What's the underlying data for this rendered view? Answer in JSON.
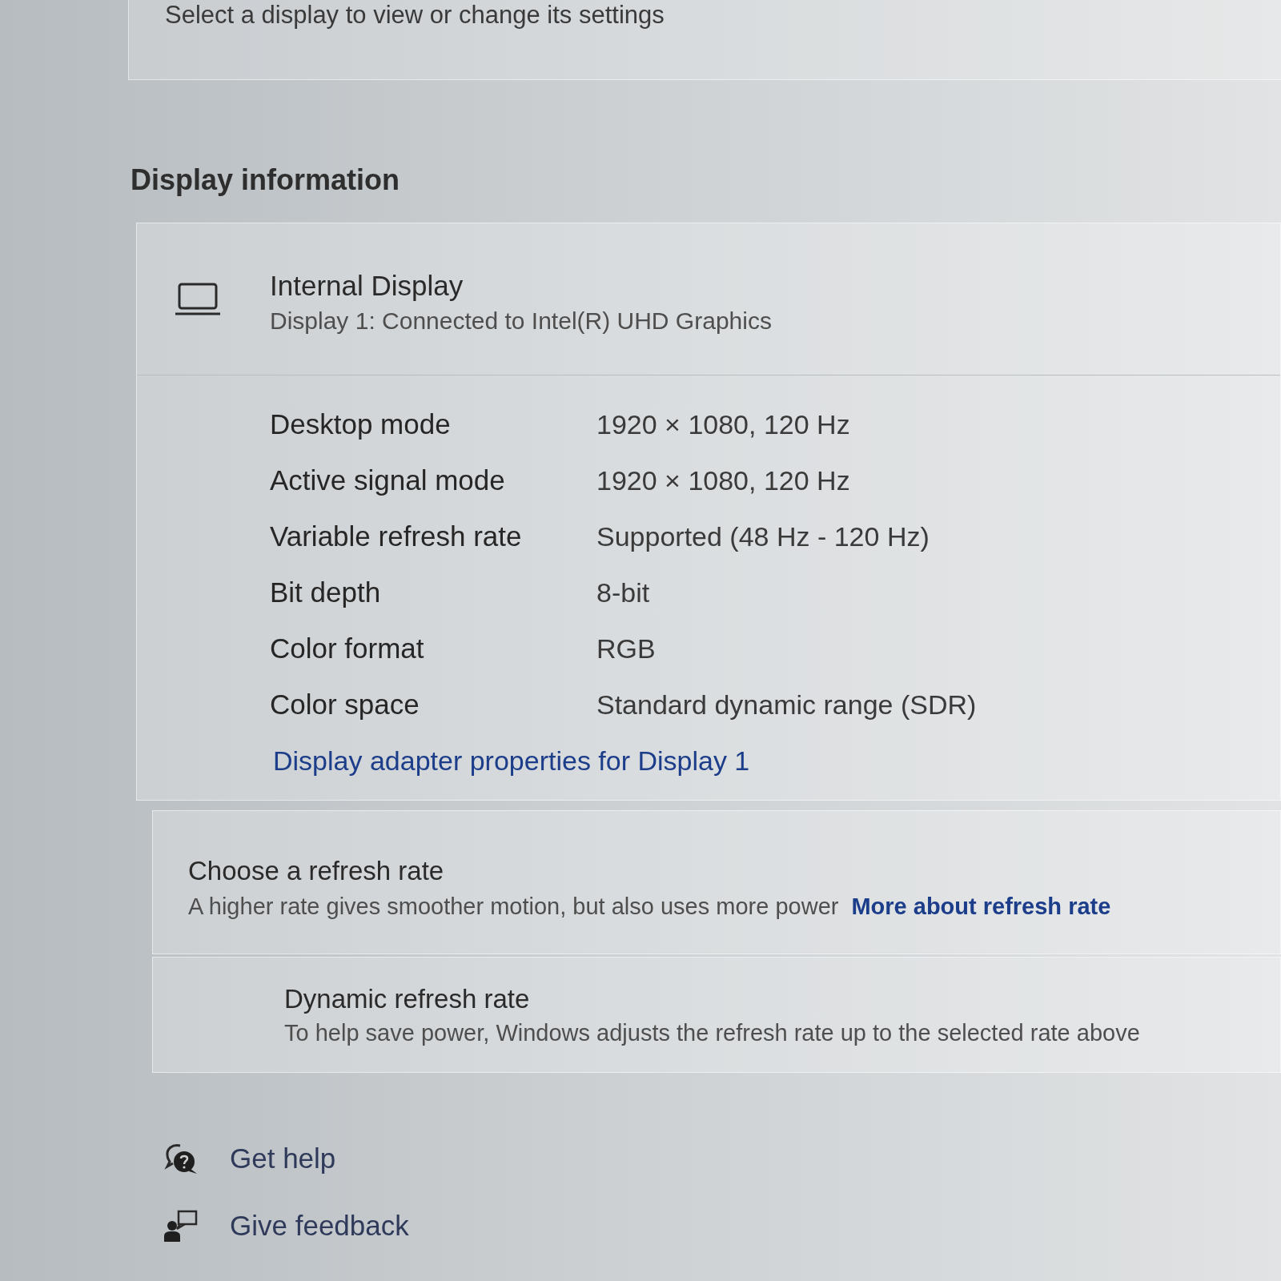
{
  "header_card": {
    "text": "Select a display to view or change its settings"
  },
  "section_title": "Display information",
  "display_card": {
    "title": "Internal Display",
    "subtitle": "Display 1: Connected to Intel(R) UHD Graphics",
    "properties": [
      {
        "label": "Desktop mode",
        "value": "1920 × 1080, 120 Hz"
      },
      {
        "label": "Active signal mode",
        "value": "1920 × 1080, 120 Hz"
      },
      {
        "label": "Variable refresh rate",
        "value": "Supported (48 Hz - 120 Hz)"
      },
      {
        "label": "Bit depth",
        "value": "8-bit"
      },
      {
        "label": "Color format",
        "value": "RGB"
      },
      {
        "label": "Color space",
        "value": "Standard dynamic range (SDR)"
      }
    ],
    "link": "Display adapter properties for Display 1"
  },
  "refresh_card": {
    "title": "Choose a refresh rate",
    "description": "A higher rate gives smoother motion, but also uses more power",
    "link": "More about refresh rate"
  },
  "dynamic_refresh": {
    "title": "Dynamic refresh rate",
    "description": "To help save power, Windows adjusts the refresh rate up to the selected rate above"
  },
  "footer_links": [
    {
      "kind": "help",
      "label": "Get help"
    },
    {
      "kind": "feedback",
      "label": "Give feedback"
    }
  ]
}
